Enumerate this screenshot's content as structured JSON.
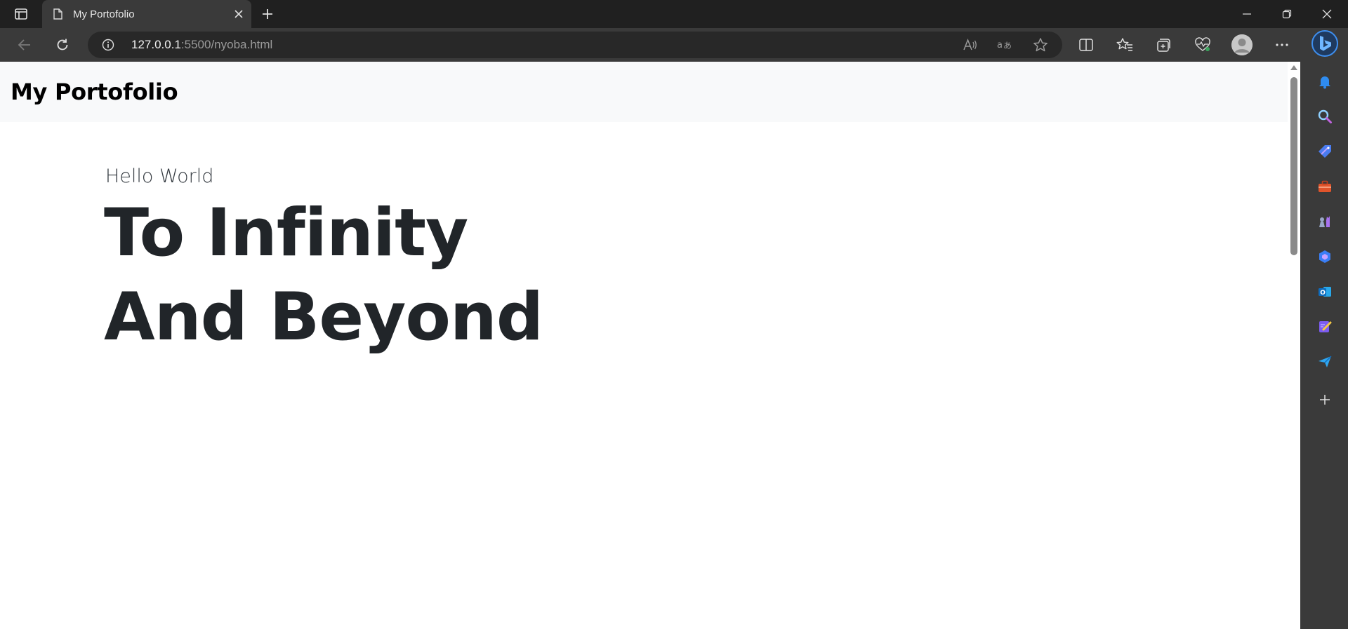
{
  "browser": {
    "tab": {
      "title": "My Portofolio"
    },
    "address": {
      "host": "127.0.0.1",
      "rest": ":5500/nyoba.html"
    }
  },
  "page": {
    "brand": "My Portofolio",
    "hero": {
      "subtitle": "Hello World",
      "line1": "To Infinity",
      "line2": "And Beyond"
    }
  },
  "icons": {
    "tab_actions": "tab-actions-icon",
    "page": "page-icon",
    "close": "close-icon",
    "new_tab": "plus-icon",
    "minimize": "minimize-icon",
    "restore": "restore-icon",
    "close_window": "close-window-icon",
    "back": "back-arrow-icon",
    "refresh": "refresh-icon",
    "info": "info-icon",
    "read_aloud": "read-aloud-icon",
    "translate": "translate-icon",
    "favorite": "star-icon",
    "split_screen": "split-screen-icon",
    "favorites": "favorites-icon",
    "collections": "collections-icon",
    "browser_essentials": "heart-pulse-icon",
    "profile": "profile-icon",
    "more": "more-icon",
    "bing": "bing-icon",
    "sidebar": [
      "bell-icon",
      "search-icon",
      "tag-icon",
      "toolbox-icon",
      "chess-icon",
      "copilot-icon",
      "outlook-icon",
      "designer-icon",
      "send-icon",
      "add-icon"
    ]
  },
  "colors": {
    "chrome_dark": "#202020",
    "toolbar": "#3a3a3a",
    "navbar_bg": "#f8f9fa",
    "headline": "#212529",
    "accent": "#3e8ff0"
  }
}
